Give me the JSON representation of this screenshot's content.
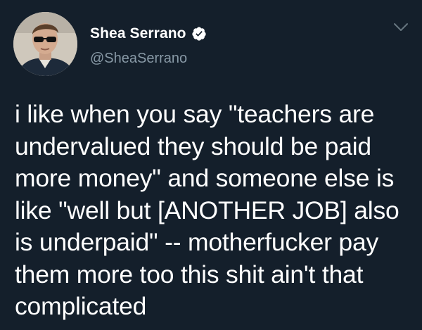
{
  "tweet": {
    "author": {
      "display_name": "Shea Serrano",
      "handle": "@SheaSerrano",
      "verified": true
    },
    "text": "i like when you say \"teachers are undervalued they should be paid more money\" and someone else is like \"well but [ANOTHER JOB] also is underpaid\" -- motherfucker pay them more too this shit ain't that complicated"
  },
  "icons": {
    "verified": "verified-badge-icon",
    "menu": "chevron-down-icon"
  },
  "colors": {
    "background": "#141f2b",
    "secondary_text": "#8899a6",
    "text": "#ffffff"
  }
}
